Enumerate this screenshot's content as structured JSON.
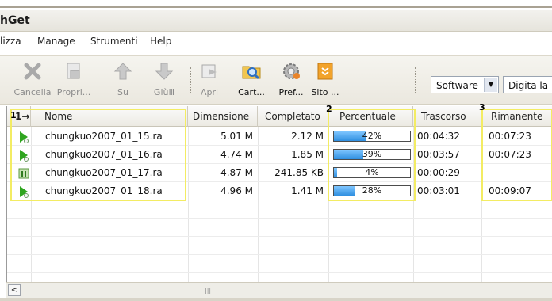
{
  "window": {
    "title": "hGet"
  },
  "menu": [
    "lizza",
    "Manage",
    "Strumenti",
    "Help"
  ],
  "toolbar": {
    "buttons": [
      {
        "label": "Cancella",
        "icon": "delete-x-icon",
        "enabled": false
      },
      {
        "label": "Propri...",
        "icon": "properties-icon",
        "enabled": false
      },
      {
        "label": "Su",
        "icon": "up-arrow-icon",
        "enabled": false
      },
      {
        "label": "GiùⅢ",
        "icon": "down-arrow-icon",
        "enabled": false
      },
      {
        "label": "Apri",
        "icon": "open-icon",
        "enabled": false
      },
      {
        "label": "Cart...",
        "icon": "folder-search-icon",
        "enabled": true
      },
      {
        "label": "Pref...",
        "icon": "preferences-gear-icon",
        "enabled": true
      },
      {
        "label": "Sito ...",
        "icon": "website-icon",
        "enabled": true
      }
    ],
    "category_select": "Software",
    "search_value": "Digita la"
  },
  "columns": {
    "marker": "1→|",
    "name": "Nome",
    "size": "Dimensione",
    "completed": "Completato",
    "percent": "Percentuale",
    "elapsed": "Trascorso",
    "remaining": "Rimanente"
  },
  "rows": [
    {
      "status_icon": "play-icon",
      "name": "chungkuo2007_01_15.ra",
      "size": "5.01 M",
      "completed": "2.12 M",
      "percent": "42%",
      "progress": 42,
      "elapsed": "00:04:32",
      "remaining": "00:07:23"
    },
    {
      "status_icon": "play-icon",
      "name": "chungkuo2007_01_16.ra",
      "size": "4.74 M",
      "completed": "1.85 M",
      "percent": "39%",
      "progress": 39,
      "elapsed": "00:03:57",
      "remaining": "00:07:23"
    },
    {
      "status_icon": "paused-icon",
      "name": "chungkuo2007_01_17.ra",
      "size": "4.87 M",
      "completed": "241.85 KB",
      "percent": "4%",
      "progress": 4,
      "elapsed": "00:00:29",
      "remaining": ""
    },
    {
      "status_icon": "play-icon",
      "name": "chungkuo2007_01_18.ra",
      "size": "4.96 M",
      "completed": "1.41 M",
      "percent": "28%",
      "progress": 28,
      "elapsed": "00:03:01",
      "remaining": "00:09:07"
    }
  ],
  "annotations": [
    "1",
    "2",
    "3"
  ],
  "colors": {
    "highlight": "#f3ec63",
    "progress": "#2f8fe0",
    "play": "#2fa51f"
  }
}
